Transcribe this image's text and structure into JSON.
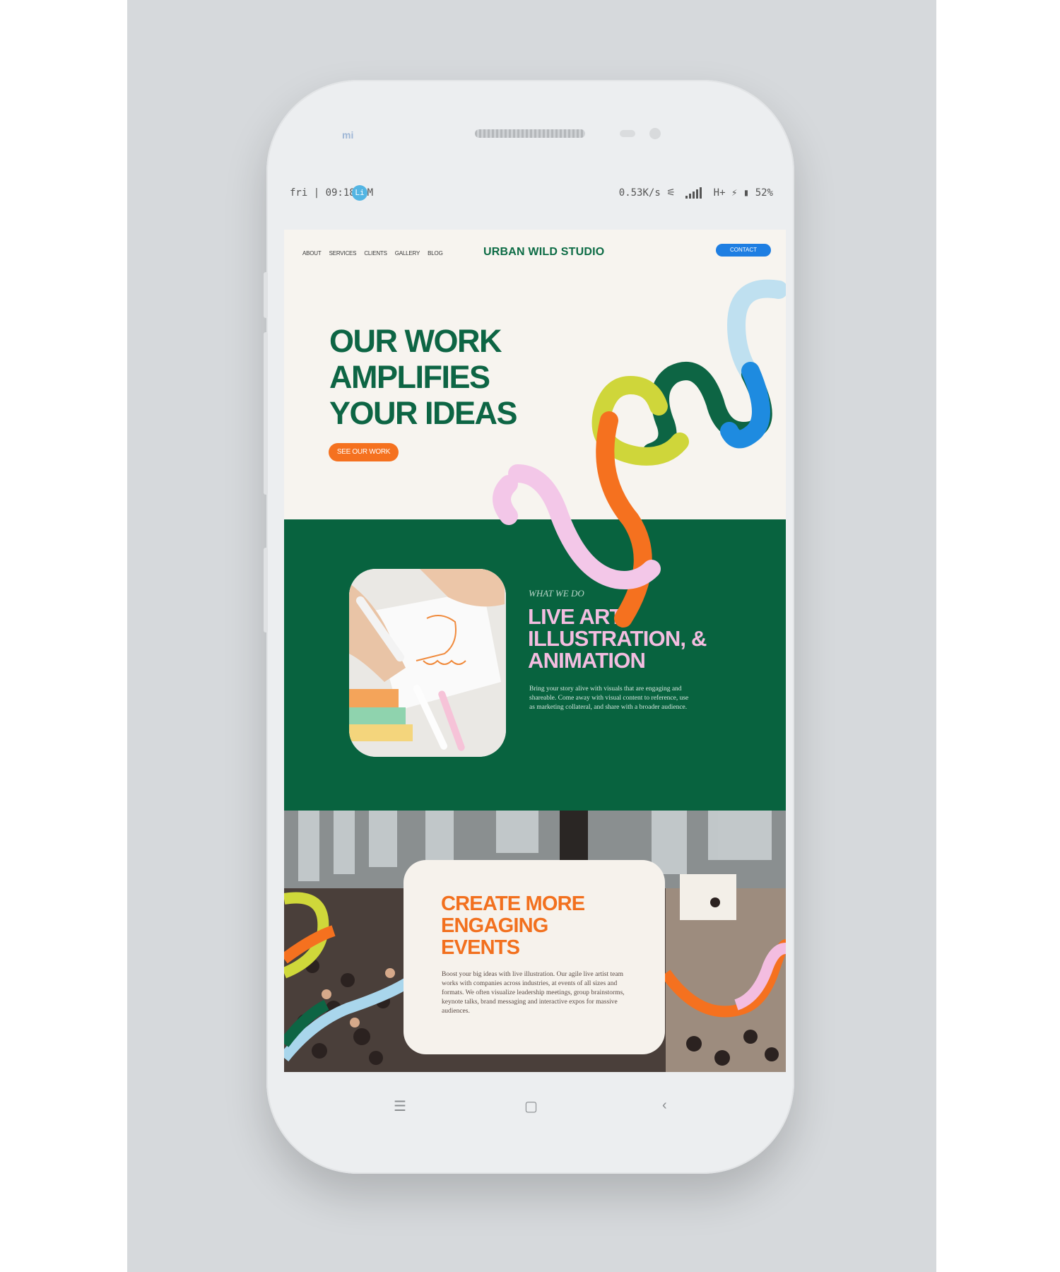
{
  "status_bar": {
    "time": "fri | 09:18 AM",
    "notification_badge": "Li",
    "speed": "0.53K/s",
    "network": "H+",
    "battery": "52%"
  },
  "device": {
    "brand": "mi"
  },
  "site": {
    "nav": [
      "ABOUT",
      "SERVICES",
      "CLIENTS",
      "GALLERY",
      "BLOG"
    ],
    "logo": "URBAN WILD STUDIO",
    "contact_label": "CONTACT",
    "hero": {
      "title": "OUR WORK AMPLIFIES YOUR IDEAS",
      "button_label": "SEE OUR WORK"
    },
    "services": {
      "eyebrow": "WHAT WE DO",
      "title": "LIVE ART, ILLUSTRATION, & ANIMATION",
      "body": "Bring your story alive with visuals that are engaging and shareable. Come away with visual content to reference, use as marketing collateral, and share with a broader audience."
    },
    "events": {
      "title": "CREATE MORE ENGAGING EVENTS",
      "body": "Boost your big ideas with live illustration. Our agile live artist team works with companies across industries, at events of all sizes and formats. We often visualize leadership meetings, group brainstorms, keynote talks, brand messaging and interactive expos for massive audiences."
    }
  },
  "colors": {
    "brand_green": "#08633f",
    "accent_orange": "#f5711f",
    "accent_blue": "#1e7ee2",
    "accent_pink": "#f3bde0"
  }
}
